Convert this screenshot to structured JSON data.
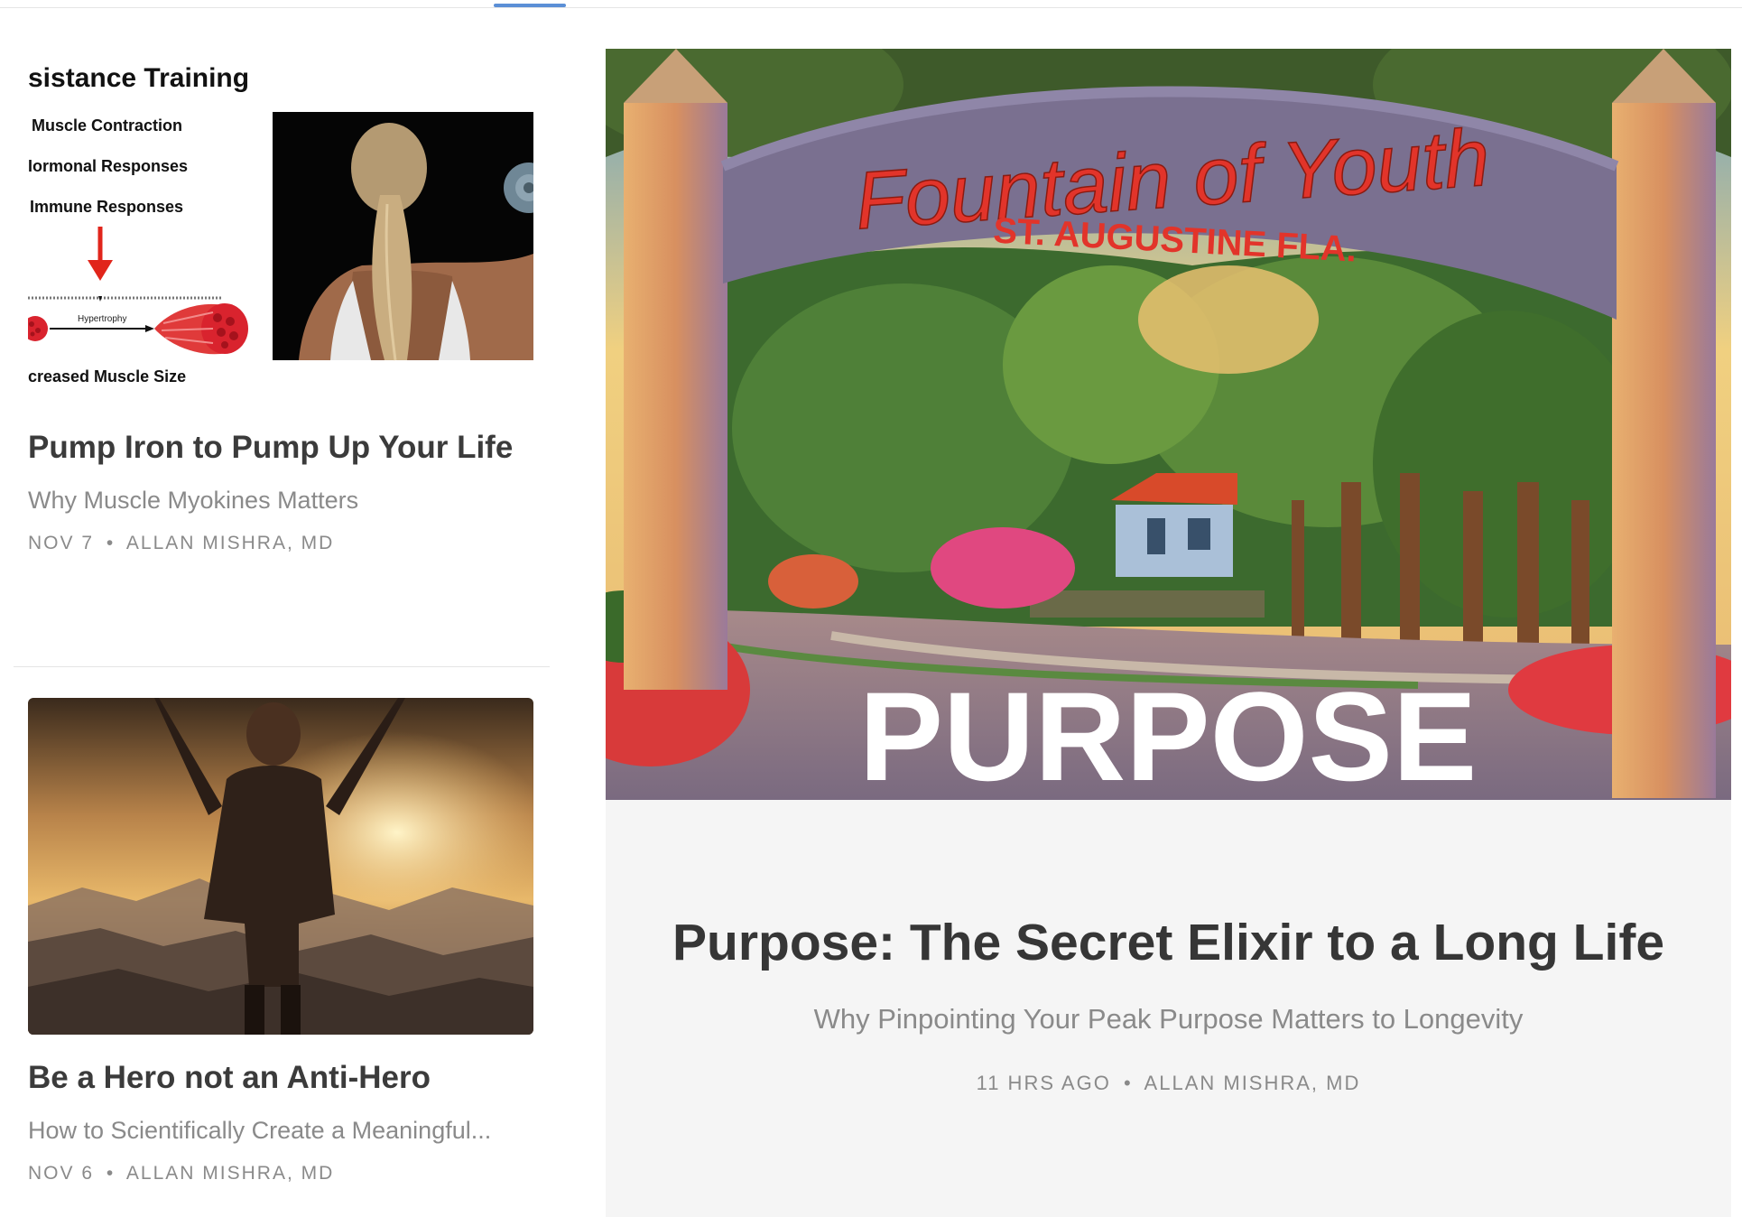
{
  "posts": [
    {
      "title": "Pump Iron to Pump Up Your Life",
      "subtitle": "Why Muscle Myokines Matters",
      "date": "NOV 7",
      "author": "ALLAN MISHRA, MD",
      "image": {
        "heading": "sistance Training",
        "lines": [
          "Muscle Contraction",
          "Iormonal Responses",
          "Immune Responses"
        ],
        "diagram_label": "Hypertrophy",
        "footer": "creased Muscle Size"
      }
    },
    {
      "title": "Be a Hero not an Anti-Hero",
      "subtitle": "How to Scientifically Create a Meaningful...",
      "date": "NOV 6",
      "author": "ALLAN MISHRA, MD"
    }
  ],
  "featured": {
    "title": "Purpose: The Secret Elixir to a Long Life",
    "subtitle": "Why Pinpointing Your Peak Purpose Matters to Longevity",
    "time": "11 HRS AGO",
    "author": "ALLAN MISHRA, MD",
    "image": {
      "arch_text": "Fountain of Youth",
      "arch_subtext": "ST. AUGUSTINE FLA.",
      "overlay": "PURPOSE"
    }
  },
  "separator": "•",
  "colors": {
    "accent": "#5b8fd6",
    "arch_red": "#e2342a",
    "feature_bg": "#f5f5f5"
  }
}
